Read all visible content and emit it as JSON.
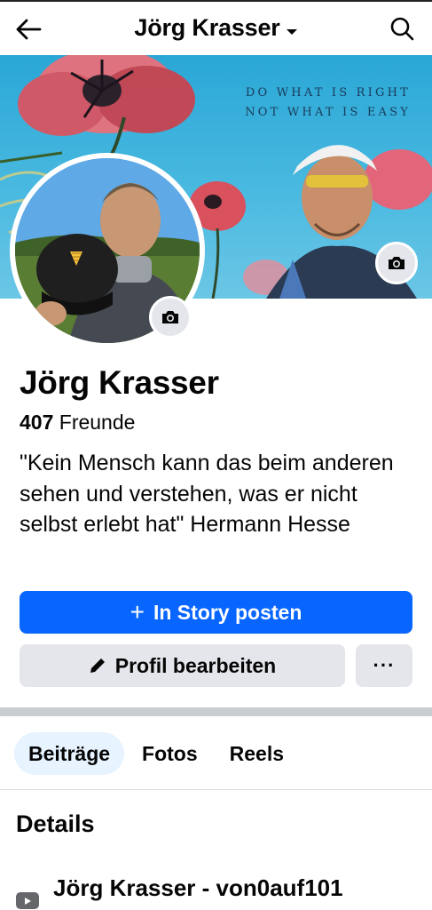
{
  "header": {
    "title": "Jörg Krasser",
    "back_icon": "arrow-left-icon",
    "caret_icon": "caret-down-icon",
    "search_icon": "search-icon"
  },
  "cover": {
    "quote_line1": "DO WHAT IS RIGHT",
    "quote_line2": "NOT WHAT IS EASY",
    "camera_icon": "camera-icon"
  },
  "profile": {
    "name": "Jörg Krasser",
    "friends_count": "407",
    "friends_label": "Freunde",
    "bio": "\"Kein Mensch kann das beim anderen sehen und verstehen, was er nicht selbst erlebt hat\" Hermann Hesse",
    "avatar_camera_icon": "camera-icon"
  },
  "actions": {
    "story_plus": "+",
    "story_label": "In Story posten",
    "edit_label": "Profil bearbeiten",
    "more_label": "···",
    "primary_color": "#0866ff"
  },
  "tabs": [
    {
      "label": "Beiträge",
      "active": true
    },
    {
      "label": "Fotos",
      "active": false
    },
    {
      "label": "Reels",
      "active": false
    }
  ],
  "details": {
    "heading": "Details",
    "items": [
      {
        "icon": "youtube-icon",
        "text": "Jörg Krasser - von0auf101"
      }
    ]
  }
}
